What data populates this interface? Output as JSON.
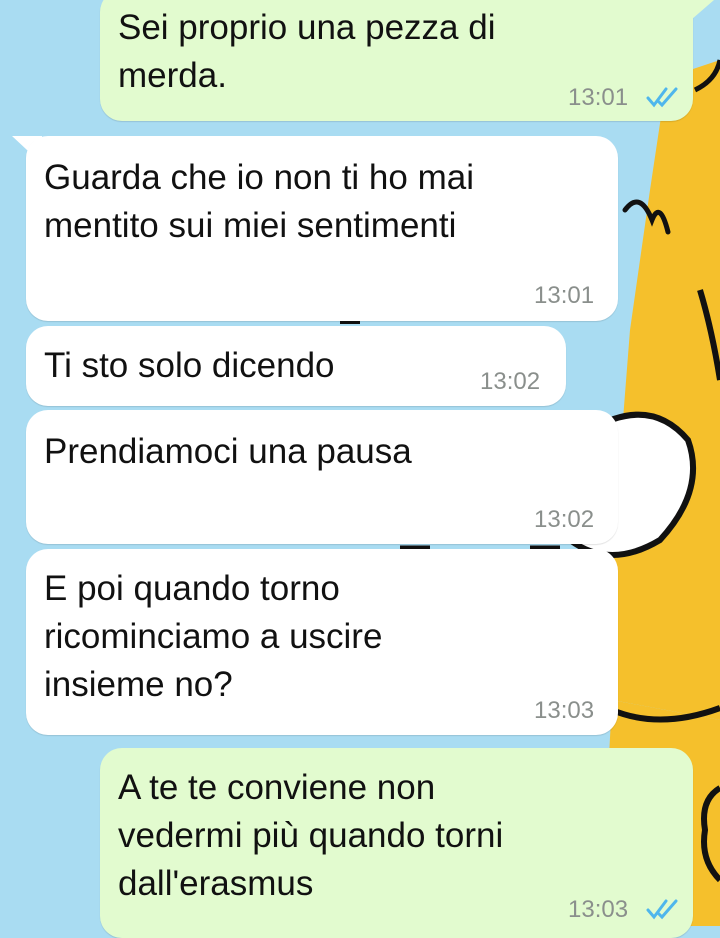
{
  "colors": {
    "background": "#a9dcf2",
    "outgoing_bubble": "#e2fbcf",
    "incoming_bubble": "#ffffff",
    "read_ticks": "#4fb6ec",
    "wallpaper_character": "#f5c02c"
  },
  "messages": [
    {
      "direction": "outgoing",
      "text": "Sei proprio una pezza di\nmerda.",
      "time": "13:01",
      "status_icon": "double-check-read-icon"
    },
    {
      "direction": "incoming",
      "text": "Guarda che io non ti ho mai\nmentito sui miei sentimenti",
      "time": "13:01"
    },
    {
      "direction": "incoming",
      "text": "Ti sto solo dicendo",
      "time": "13:02"
    },
    {
      "direction": "incoming",
      "text": "Prendiamoci una pausa",
      "time": "13:02"
    },
    {
      "direction": "incoming",
      "text": "E poi quando torno\nricominciamo a uscire\ninsieme no?",
      "time": "13:03"
    },
    {
      "direction": "outgoing",
      "text": "A te te conviene non\nvedermi più quando torni\ndall'erasmus",
      "time": "13:03",
      "status_icon": "double-check-read-icon"
    }
  ]
}
